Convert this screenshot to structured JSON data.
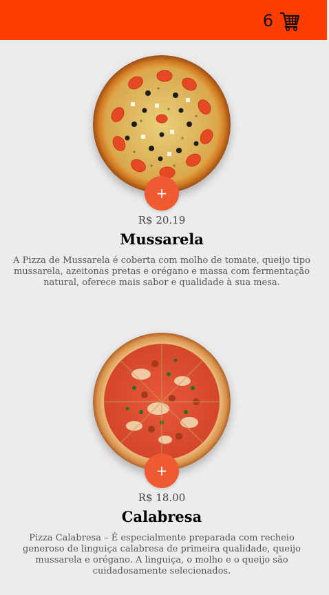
{
  "header": {
    "cart_count": "6",
    "cart_icon": "shopping-cart-icon",
    "bar_color": "#ff3d00"
  },
  "products": [
    {
      "price": "R$ 20.19",
      "name": "Mussarela",
      "description": "A Pizza de Mussarela é coberta com molho de tomate, queijo tipo mussarela, azeitonas pretas e orégano e massa com fermentação natural, oferece mais sabor e qualidade à sua mesa.",
      "add_label": "+",
      "image": "mussarela-pizza-image"
    },
    {
      "price": "R$ 18.00",
      "name": "Calabresa",
      "description": "Pizza Calabresa – É especialmente preparada com recheio generoso de linguiça calabresa de primeira qualidade, queijo mussarela e orégano. A linguiça, o molho e o queijo são cuidadosamente selecionados.",
      "add_label": "+",
      "image": "calabresa-pizza-image"
    }
  ],
  "accent_color": "#f05a32"
}
